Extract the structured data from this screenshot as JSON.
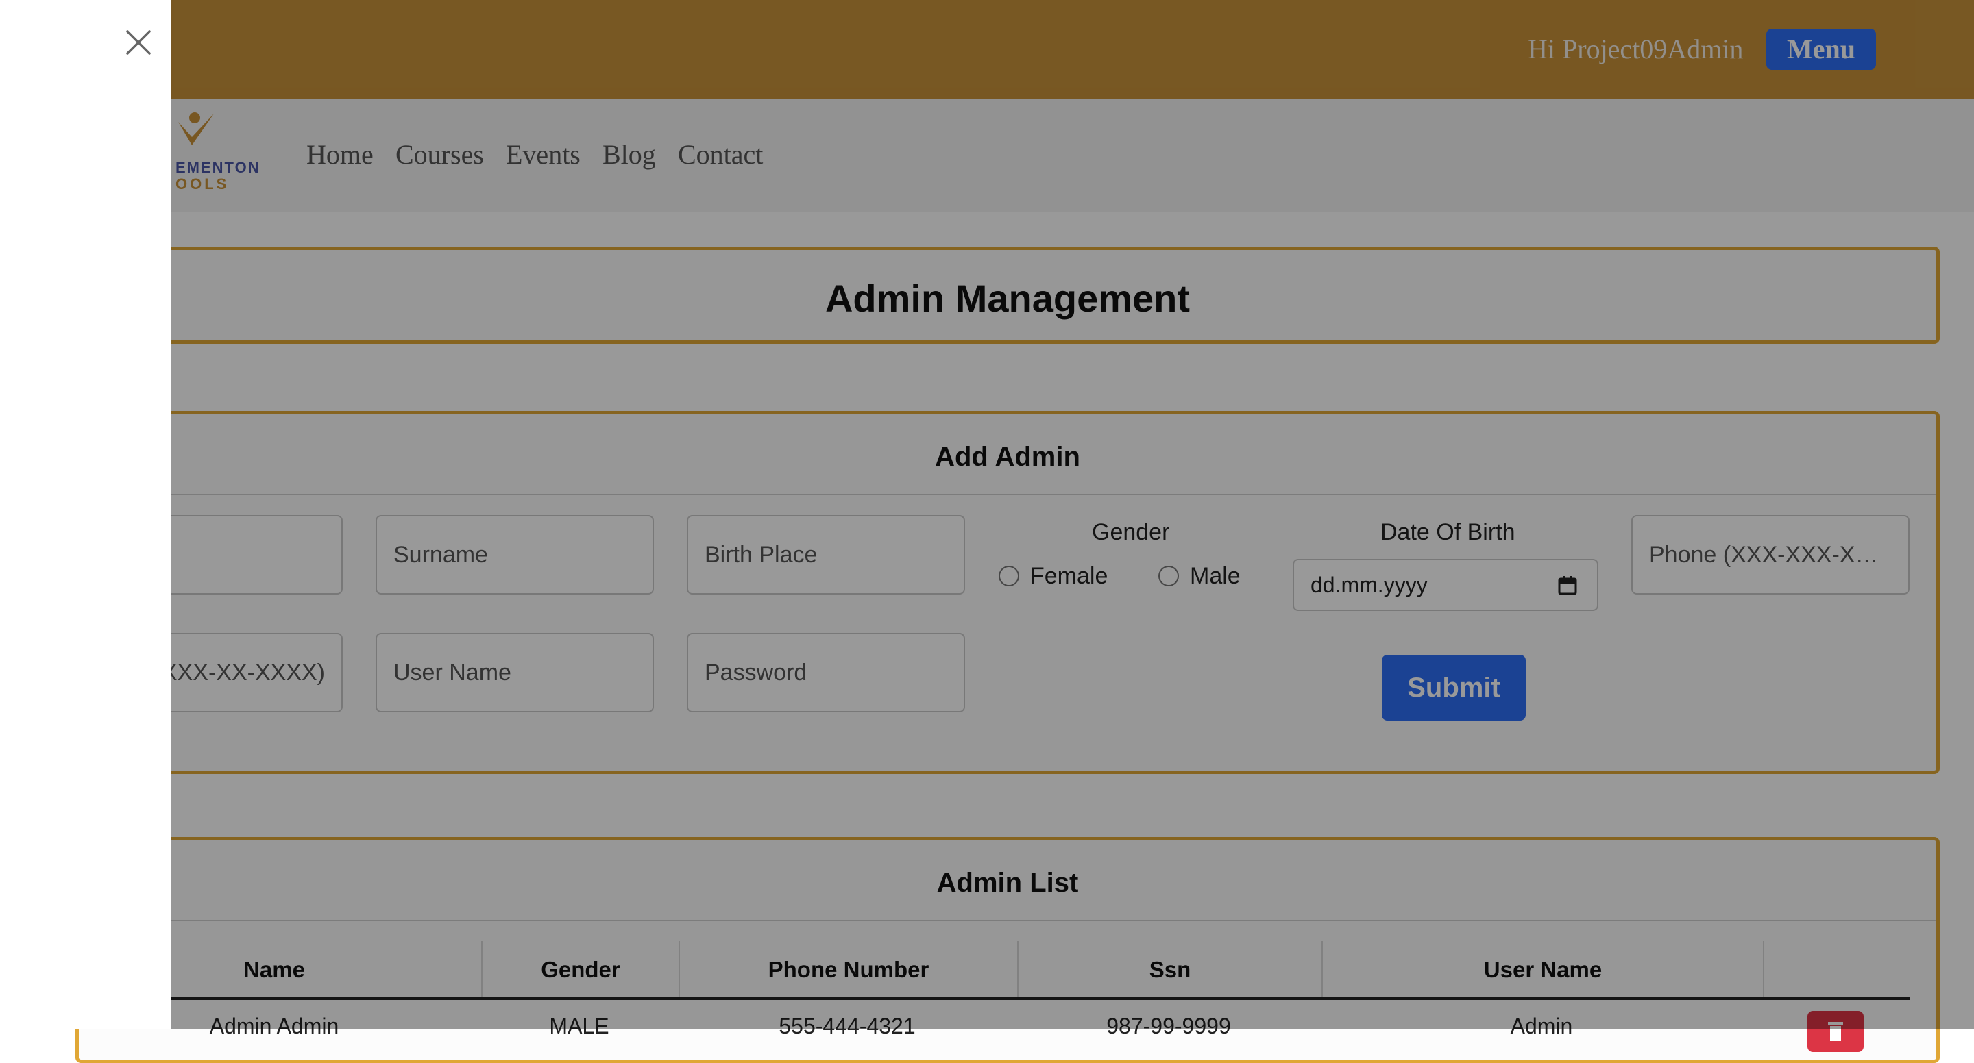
{
  "header": {
    "greeting": "Hi Project09Admin",
    "menu_label": "Menu",
    "bar_color": "#c8923a",
    "button_color": "#2d6ef5"
  },
  "logo": {
    "line1": "EMENTON",
    "line2": "OOLS"
  },
  "nav": {
    "items": [
      "Home",
      "Courses",
      "Events",
      "Blog",
      "Contact"
    ]
  },
  "page": {
    "title": "Admin Management"
  },
  "add_admin": {
    "title": "Add Admin",
    "fields": {
      "surname": "Surname",
      "birth_place": "Birth Place",
      "phone": "Phone (XXX-XXX-XXXX)",
      "ssn": "SSN (XXX-XX-XXXX)",
      "username": "User Name",
      "password": "Password"
    },
    "gender": {
      "label": "Gender",
      "options": [
        "Female",
        "Male"
      ]
    },
    "dob": {
      "label": "Date Of Birth",
      "placeholder": "dd.mm.yyyy"
    },
    "submit_label": "Submit"
  },
  "admin_list": {
    "title": "Admin List",
    "columns": [
      "Name",
      "Gender",
      "Phone Number",
      "Ssn",
      "User Name"
    ],
    "rows": [
      {
        "name": "Admin Admin",
        "gender": "MALE",
        "phone": "555-444-4321",
        "ssn": "987-99-9999",
        "username": "Admin"
      }
    ]
  },
  "offcanvas": {
    "close_icon": "close-icon"
  }
}
